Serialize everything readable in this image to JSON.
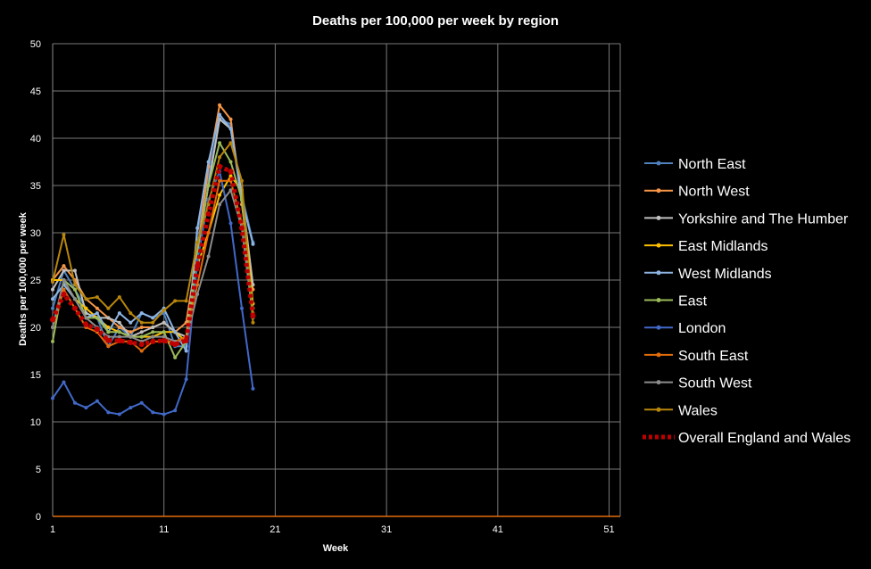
{
  "chart_data": {
    "type": "line",
    "title": "Deaths per 100,000 per week by region",
    "xlabel": "Week",
    "ylabel": "Deaths per 100,000 per week",
    "xlim": [
      1,
      52
    ],
    "ylim": [
      0,
      50
    ],
    "xticks": [
      1,
      11,
      21,
      31,
      41,
      51
    ],
    "yticks": [
      0,
      5,
      10,
      15,
      20,
      25,
      30,
      35,
      40,
      45,
      50
    ],
    "grid": true,
    "legend_position": "right",
    "x": [
      1,
      2,
      3,
      4,
      5,
      6,
      7,
      8,
      9,
      10,
      11,
      12,
      13,
      14,
      15,
      16,
      17,
      18,
      19
    ],
    "series": [
      {
        "name": "North East",
        "color": "#4F81BD",
        "values": [
          22.0,
          26.0,
          24.0,
          22.0,
          21.0,
          18.0,
          20.0,
          19.0,
          21.5,
          21.0,
          21.5,
          18.0,
          18.0,
          30.0,
          36.0,
          42.0,
          41.5,
          34.0,
          29.0
        ]
      },
      {
        "name": "North West",
        "color": "#F79646",
        "values": [
          25.0,
          26.5,
          25.0,
          23.0,
          22.0,
          21.0,
          20.0,
          19.5,
          20.0,
          20.0,
          20.5,
          19.5,
          20.5,
          28.0,
          37.0,
          43.5,
          42.0,
          33.0,
          24.0
        ]
      },
      {
        "name": "Yorkshire and The Humber",
        "color": "#C0C0C0",
        "values": [
          24.0,
          26.0,
          26.0,
          21.5,
          21.0,
          21.0,
          20.5,
          19.0,
          19.5,
          20.0,
          20.5,
          19.5,
          19.0,
          28.0,
          35.0,
          42.0,
          41.0,
          34.0,
          24.5
        ]
      },
      {
        "name": "East Midlands",
        "color": "#FFC000",
        "values": [
          25.0,
          25.0,
          23.0,
          22.0,
          21.0,
          20.0,
          19.5,
          19.0,
          19.0,
          19.0,
          19.5,
          19.5,
          18.5,
          26.5,
          30.0,
          34.0,
          36.0,
          34.5,
          22.5
        ]
      },
      {
        "name": "West Midlands",
        "color": "#8DB4E2",
        "values": [
          23.0,
          24.5,
          23.0,
          21.0,
          21.5,
          19.5,
          21.5,
          20.5,
          21.5,
          21.0,
          22.0,
          19.5,
          17.5,
          30.5,
          37.5,
          42.5,
          41.0,
          33.5,
          28.8
        ]
      },
      {
        "name": "East",
        "color": "#9BBB59",
        "values": [
          18.5,
          25.0,
          24.0,
          21.0,
          21.0,
          19.5,
          19.5,
          19.0,
          19.0,
          19.5,
          19.5,
          16.8,
          18.5,
          28.0,
          35.0,
          39.5,
          37.5,
          33.5,
          22.0
        ]
      },
      {
        "name": "London",
        "color": "#4169C8",
        "values": [
          12.5,
          14.2,
          12.0,
          11.5,
          12.2,
          11.0,
          10.8,
          11.5,
          12.0,
          11.0,
          10.8,
          11.2,
          14.5,
          27.0,
          33.5,
          36.5,
          31.0,
          22.0,
          13.5
        ]
      },
      {
        "name": "South East",
        "color": "#E46C0A",
        "values": [
          20.0,
          24.0,
          22.0,
          20.0,
          19.5,
          18.0,
          18.5,
          18.5,
          17.5,
          18.5,
          18.5,
          18.5,
          19.0,
          24.5,
          30.0,
          35.5,
          35.5,
          31.0,
          21.5
        ]
      },
      {
        "name": "South West",
        "color": "#8C8C8C",
        "values": [
          20.0,
          25.0,
          23.0,
          21.0,
          20.0,
          19.0,
          19.0,
          19.0,
          18.5,
          19.0,
          19.0,
          18.5,
          18.5,
          23.5,
          27.5,
          33.0,
          34.5,
          30.5,
          21.0
        ]
      },
      {
        "name": "Wales",
        "color": "#B8860B",
        "values": [
          24.8,
          29.8,
          24.5,
          23.0,
          23.2,
          22.0,
          23.2,
          21.5,
          20.5,
          20.5,
          21.8,
          22.8,
          22.8,
          29.0,
          33.0,
          38.0,
          39.5,
          35.5,
          20.5
        ]
      },
      {
        "name": "Overall England and Wales",
        "color": "#C00000",
        "dashed": true,
        "values": [
          20.8,
          23.5,
          22.0,
          20.3,
          19.8,
          18.6,
          18.6,
          18.4,
          18.2,
          18.5,
          18.6,
          18.2,
          18.6,
          26.5,
          32.0,
          37.0,
          36.5,
          30.5,
          21.2
        ]
      }
    ]
  }
}
